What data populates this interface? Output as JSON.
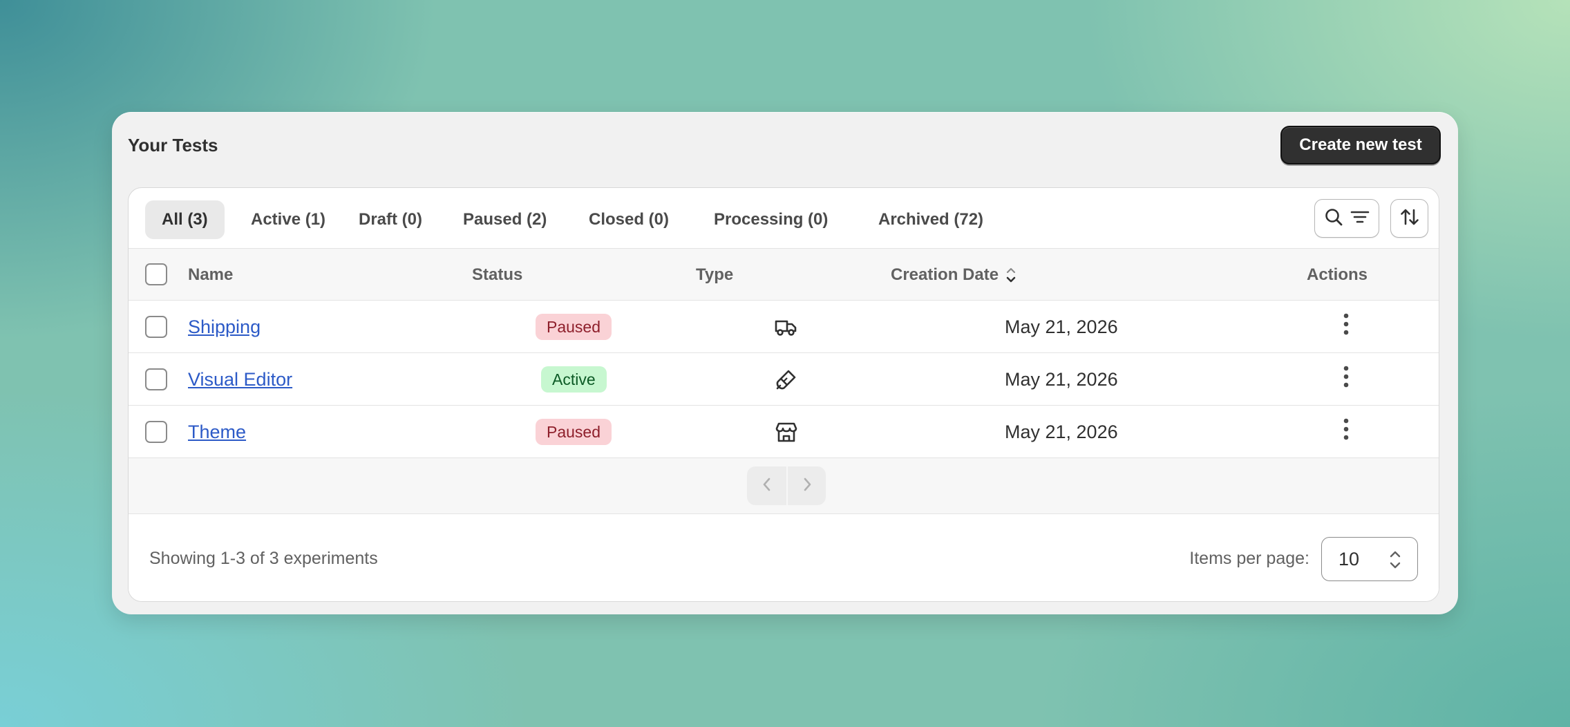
{
  "card": {
    "title": "Your Tests",
    "create_label": "Create new test"
  },
  "tabs": [
    {
      "label": "All (3)",
      "selected": true
    },
    {
      "label": "Active (1)",
      "selected": false
    },
    {
      "label": "Draft (0)",
      "selected": false
    },
    {
      "label": "Paused (2)",
      "selected": false
    },
    {
      "label": "Closed (0)",
      "selected": false
    },
    {
      "label": "Processing (0)",
      "selected": false
    },
    {
      "label": "Archived (72)",
      "selected": false
    }
  ],
  "toolbar": {
    "search_filter_icons": [
      "search-icon",
      "filter-lines-icon"
    ],
    "sort_icon": "sort-arrows-icon"
  },
  "columns": {
    "name": "Name",
    "status": "Status",
    "type": "Type",
    "creation_date": "Creation Date",
    "actions": "Actions"
  },
  "rows": [
    {
      "name": "Shipping",
      "status": "Paused",
      "type_icon": "truck-icon",
      "date": "May 21, 2026"
    },
    {
      "name": "Visual Editor",
      "status": "Active",
      "type_icon": "paintbrush-icon",
      "date": "May 21, 2026"
    },
    {
      "name": "Theme",
      "status": "Paused",
      "type_icon": "store-icon",
      "date": "May 21, 2026"
    }
  ],
  "pagination": {
    "showing": "Showing 1-3 of 3 experiments",
    "items_per_page_label": "Items per page:",
    "items_per_page_value": "10"
  },
  "colors": {
    "primary_button": "#303030",
    "link": "#2c5ac7",
    "badge_paused_bg": "#fad2d6",
    "badge_paused_text": "#8e1f2b",
    "badge_active_bg": "#c7f7d0",
    "badge_active_text": "#0c5a25"
  }
}
